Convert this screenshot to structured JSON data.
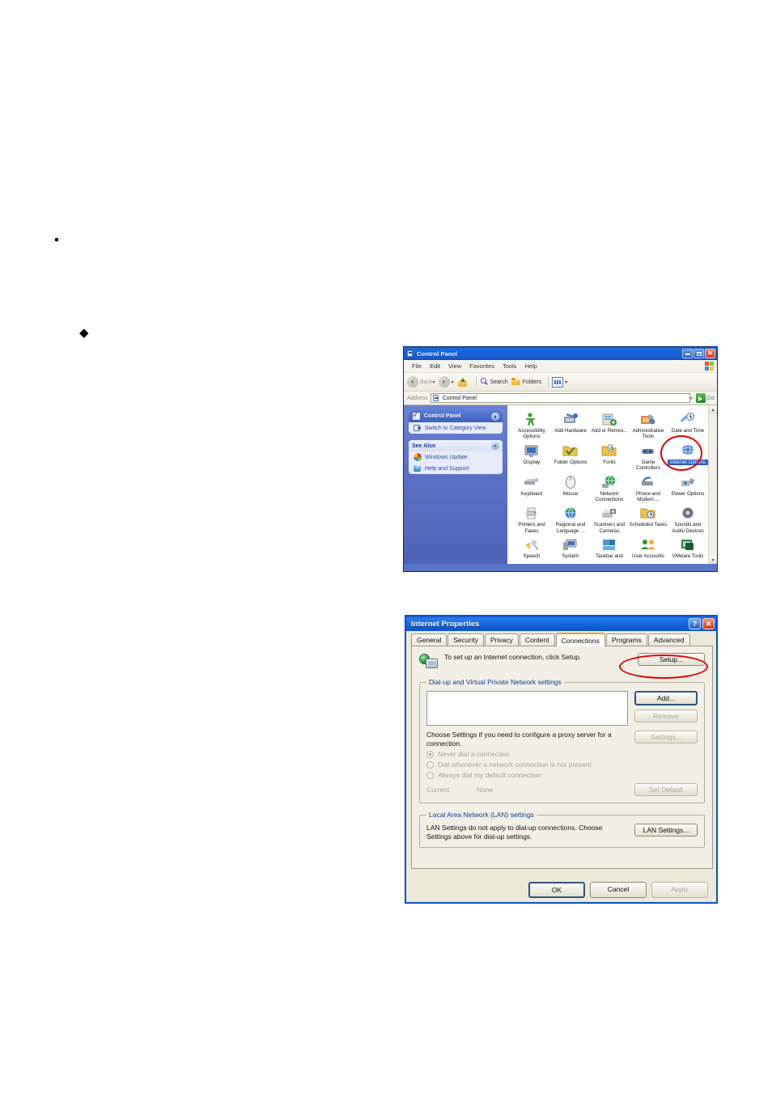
{
  "document": {
    "bullets": [
      {
        "name": "round-bullet",
        "glyph": "•"
      },
      {
        "name": "diamond-bullet",
        "glyph": "◆"
      }
    ]
  },
  "control_panel": {
    "title": "Control Panel",
    "title_icon": "control-panel-icon",
    "window_buttons": {
      "minimize": "minimize-button",
      "maximize": "maximize-button",
      "close": "✕"
    },
    "menu": [
      "File",
      "Edit",
      "View",
      "Favorites",
      "Tools",
      "Help"
    ],
    "toolbar": {
      "back": "Back",
      "forward": "",
      "up": "up-one-level-icon",
      "search": "Search",
      "folders": "Folders",
      "views": "views-icon",
      "views_caret": "▾"
    },
    "address": {
      "label": "Address",
      "value": "Control Panel",
      "caret": "▾",
      "go": "Go"
    },
    "sidebar": {
      "panel1": {
        "header": "Control Panel",
        "chevron": "▲",
        "links": [
          {
            "label": "Switch to Category View",
            "icon": "switch-view-icon"
          }
        ]
      },
      "panel2": {
        "header": "See Also",
        "chevron": "▲",
        "links": [
          {
            "label": "Windows Update",
            "icon": "windows-update-icon"
          },
          {
            "label": "Help and Support",
            "icon": "help-and-support-icon"
          }
        ]
      }
    },
    "icons": [
      {
        "label": "Accessibility Options",
        "name": "accessibility-options"
      },
      {
        "label": "Add Hardware",
        "name": "add-hardware"
      },
      {
        "label": "Add or Remov...",
        "name": "add-or-remove-programs"
      },
      {
        "label": "Administrative Tools",
        "name": "administrative-tools"
      },
      {
        "label": "Date and Time",
        "name": "date-and-time"
      },
      {
        "label": "Display",
        "name": "display"
      },
      {
        "label": "Folder Options",
        "name": "folder-options"
      },
      {
        "label": "Fonts",
        "name": "fonts"
      },
      {
        "label": "Game Controllers",
        "name": "game-controllers"
      },
      {
        "label": "Internet Options",
        "name": "internet-options",
        "selected": true
      },
      {
        "label": "Keyboard",
        "name": "keyboard"
      },
      {
        "label": "Mouse",
        "name": "mouse"
      },
      {
        "label": "Network Connections",
        "name": "network-connections"
      },
      {
        "label": "Phone and Modem ...",
        "name": "phone-and-modem"
      },
      {
        "label": "Power Options",
        "name": "power-options"
      },
      {
        "label": "Printers and Faxes",
        "name": "printers-and-faxes"
      },
      {
        "label": "Regional and Language ...",
        "name": "regional-and-language"
      },
      {
        "label": "Scanners and Cameras",
        "name": "scanners-and-cameras"
      },
      {
        "label": "Scheduled Tasks",
        "name": "scheduled-tasks"
      },
      {
        "label": "Sounds and Audio Devices",
        "name": "sounds-and-audio-devices"
      },
      {
        "label": "Speech",
        "name": "speech"
      },
      {
        "label": "System",
        "name": "system"
      },
      {
        "label": "Taskbar and",
        "name": "taskbar-and-start-menu"
      },
      {
        "label": "User Accounts",
        "name": "user-accounts"
      },
      {
        "label": "VMware Tools",
        "name": "vmware-tools"
      }
    ],
    "scrollbar": {
      "up": "▴",
      "down": "▾"
    }
  },
  "internet_properties": {
    "title": "Internet Properties",
    "titlebar_buttons": {
      "help": "?",
      "close": "✕"
    },
    "tabs": [
      {
        "label": "General",
        "active": false
      },
      {
        "label": "Security",
        "active": false
      },
      {
        "label": "Privacy",
        "active": false
      },
      {
        "label": "Content",
        "active": false
      },
      {
        "label": "Connections",
        "active": true
      },
      {
        "label": "Programs",
        "active": false
      },
      {
        "label": "Advanced",
        "active": false
      }
    ],
    "setup": {
      "text": "To set up an Internet connection, click Setup.",
      "button": "Setup..."
    },
    "dialup": {
      "legend": "Dial-up and Virtual Private Network settings",
      "list_items": [],
      "add_button": "Add...",
      "remove_button": "Remove",
      "settings_button": "Settings...",
      "proxy_note": "Choose Settings if you need to configure a proxy server for a connection.",
      "radios": [
        {
          "label": "Never dial a connection",
          "checked": true
        },
        {
          "label": "Dial whenever a network connection is not present",
          "checked": false
        },
        {
          "label": "Always dial my default connection",
          "checked": false
        }
      ],
      "current_label": "Current",
      "current_value": "None",
      "set_default_button": "Set Default"
    },
    "lan": {
      "legend": "Local Area Network (LAN) settings",
      "note": "LAN Settings do not apply to dial-up connections. Choose Settings above for dial-up settings.",
      "button": "LAN Settings..."
    },
    "footer": {
      "ok": "OK",
      "cancel": "Cancel",
      "apply": "Apply"
    }
  },
  "annotations": {
    "color": "#e00000",
    "highlights": [
      {
        "name": "internet-options-highlight",
        "target": "Internet Options"
      },
      {
        "name": "setup-button-highlight",
        "target": "Setup..."
      }
    ]
  }
}
